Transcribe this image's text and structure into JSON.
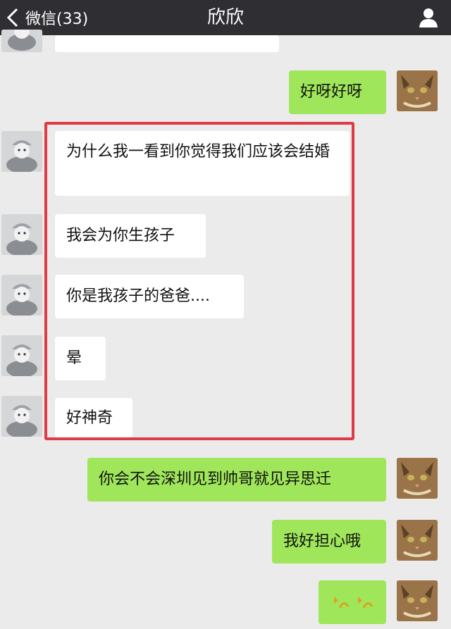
{
  "header": {
    "back_label": "微信(33)",
    "title": "欣欣"
  },
  "messages": [
    {
      "side": "out",
      "text": "好呀好呀"
    },
    {
      "side": "in",
      "text": "为什么我一看到你觉得我们应该会结婚"
    },
    {
      "side": "in",
      "text": "我会为你生孩子"
    },
    {
      "side": "in",
      "text": "你是我孩子的爸爸...."
    },
    {
      "side": "in",
      "text": "晕"
    },
    {
      "side": "in",
      "text": "好神奇"
    },
    {
      "side": "out",
      "text": "你会不会深圳见到帅哥就见异思迁"
    },
    {
      "side": "out",
      "text": "我好担心哦"
    },
    {
      "side": "out",
      "emoji": "smile-emoji"
    }
  ],
  "colors": {
    "header_bg": "#2f2f33",
    "chat_bg": "#ebebeb",
    "incoming_bubble": "#ffffff",
    "outgoing_bubble": "#9fe65a",
    "highlight_border": "#e03b45"
  }
}
